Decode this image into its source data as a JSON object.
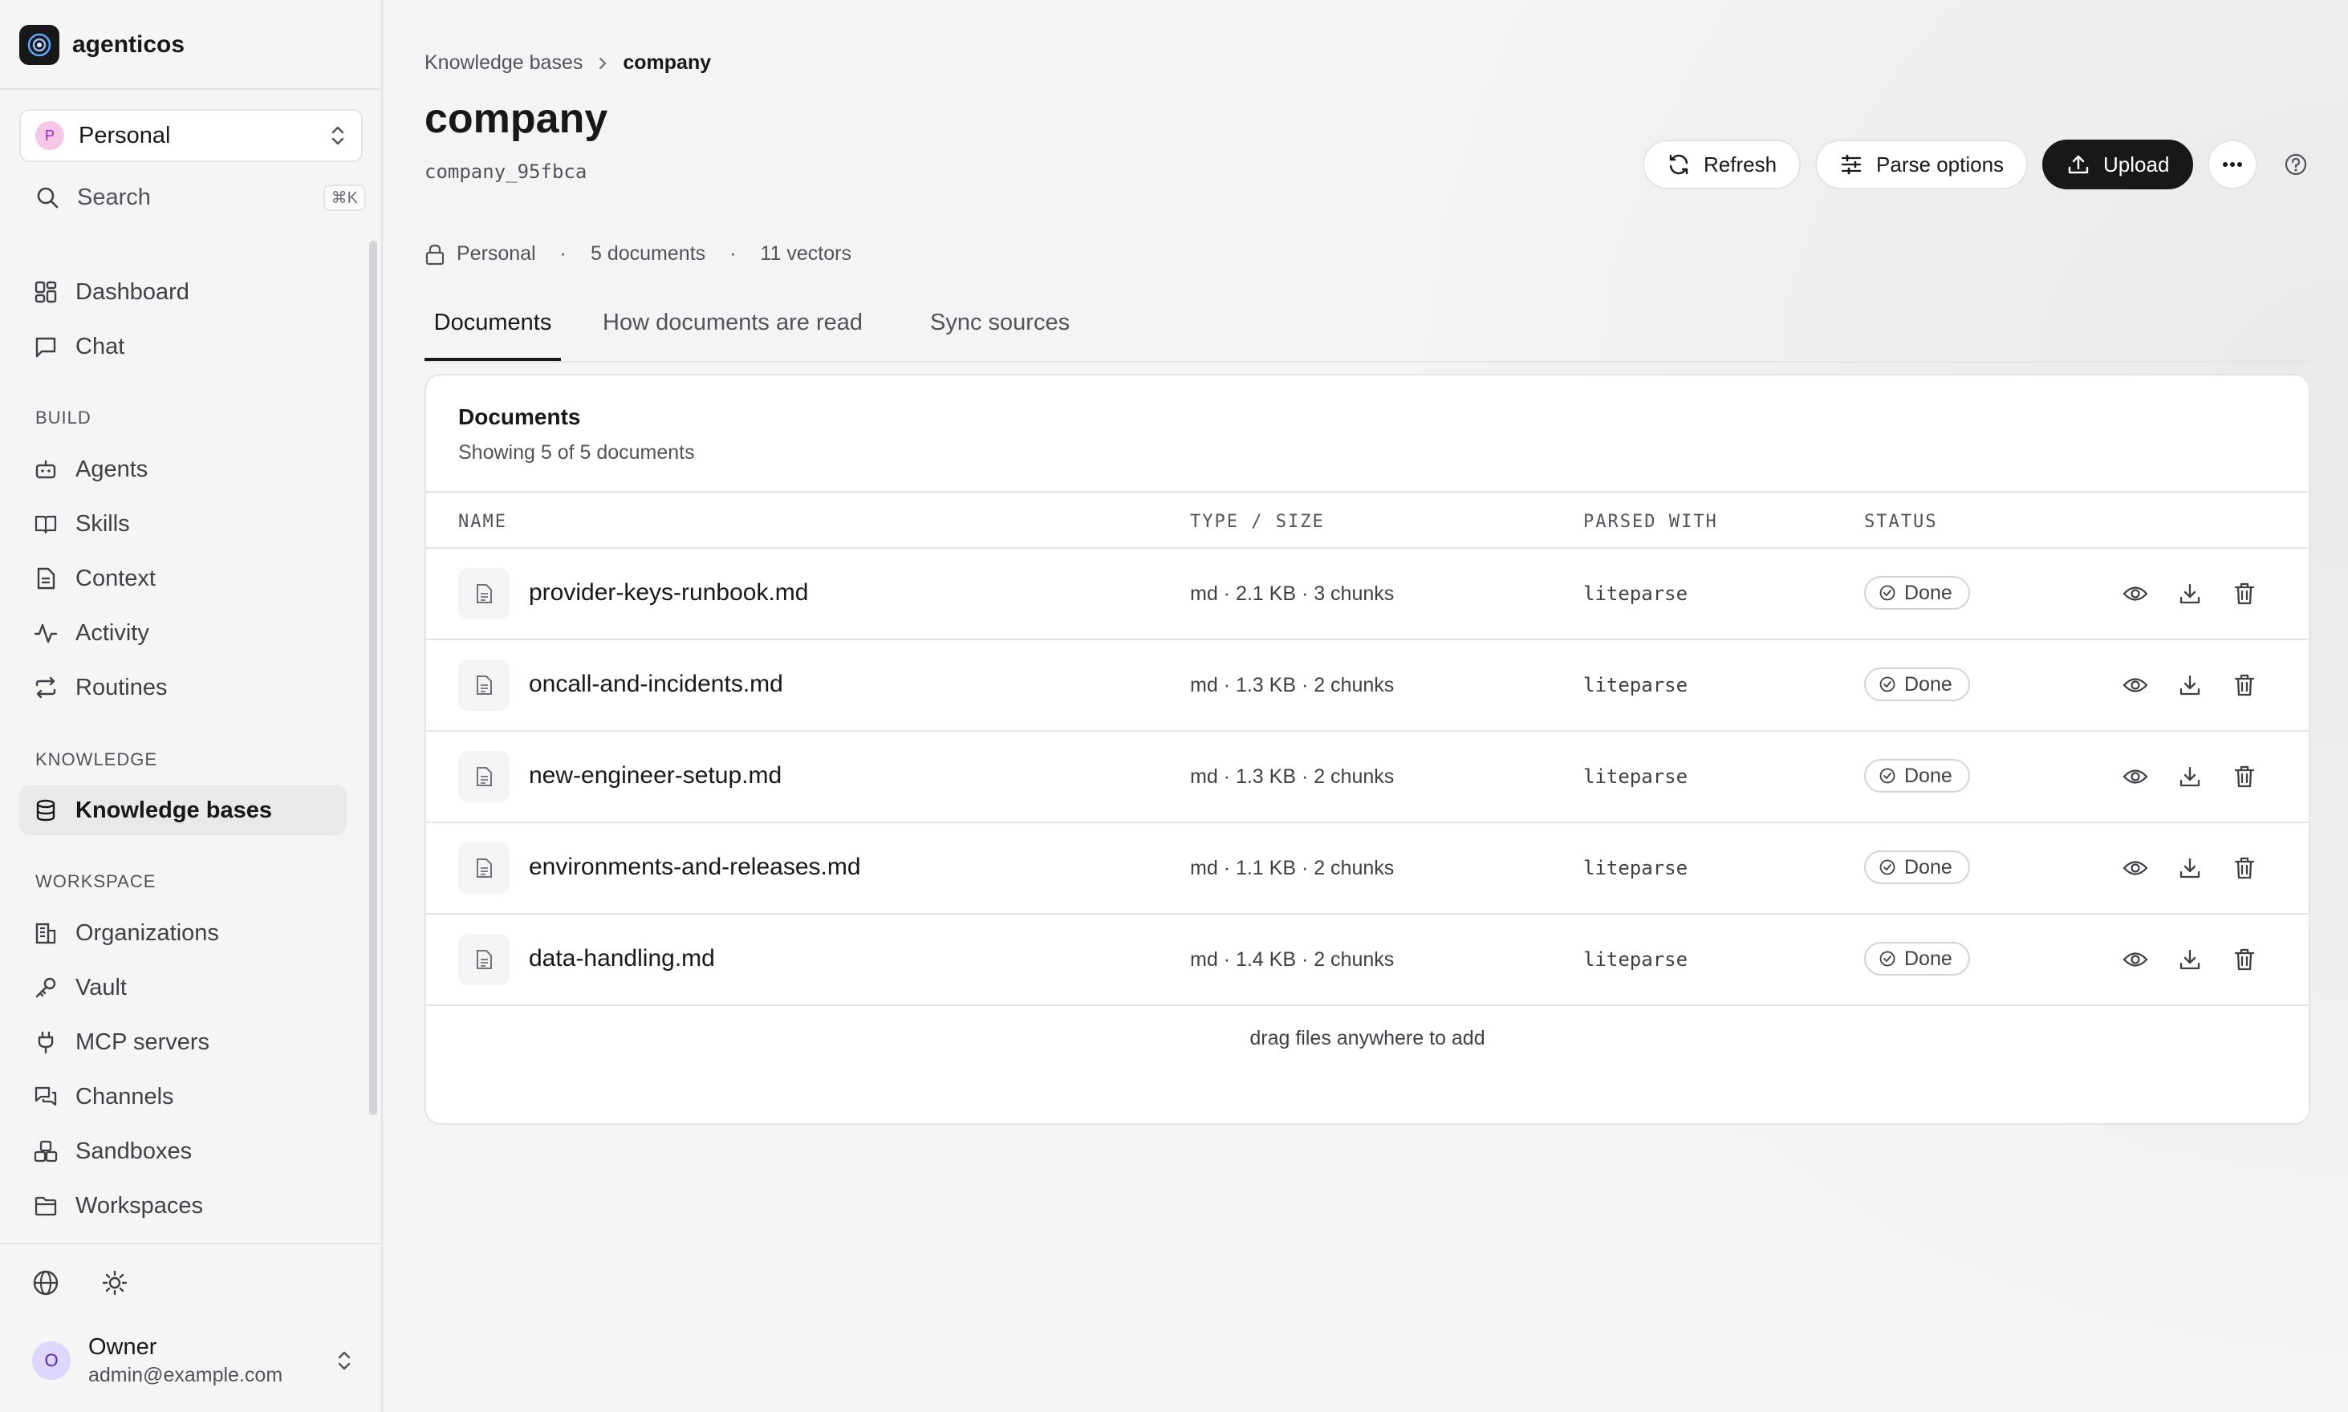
{
  "app": {
    "name": "agenticos"
  },
  "workspace": {
    "initial": "P",
    "name": "Personal"
  },
  "search": {
    "label": "Search",
    "shortcut": "⌘K"
  },
  "nav": {
    "top": [
      {
        "label": "Dashboard",
        "icon": "dashboard-icon"
      },
      {
        "label": "Chat",
        "icon": "chat-icon"
      }
    ],
    "build_title": "BUILD",
    "build": [
      {
        "label": "Agents",
        "icon": "robot-icon"
      },
      {
        "label": "Skills",
        "icon": "book-icon"
      },
      {
        "label": "Context",
        "icon": "document-icon"
      },
      {
        "label": "Activity",
        "icon": "activity-icon"
      },
      {
        "label": "Routines",
        "icon": "repeat-icon"
      }
    ],
    "knowledge_title": "KNOWLEDGE",
    "knowledge": [
      {
        "label": "Knowledge bases",
        "icon": "database-icon",
        "active": true
      }
    ],
    "workspace_title": "WORKSPACE",
    "workspace": [
      {
        "label": "Organizations",
        "icon": "building-icon"
      },
      {
        "label": "Vault",
        "icon": "key-icon"
      },
      {
        "label": "MCP servers",
        "icon": "plug-icon"
      },
      {
        "label": "Channels",
        "icon": "messages-icon"
      },
      {
        "label": "Sandboxes",
        "icon": "boxes-icon"
      },
      {
        "label": "Workspaces",
        "icon": "folder-icon"
      }
    ]
  },
  "user": {
    "initial": "O",
    "name": "Owner",
    "email": "admin@example.com"
  },
  "breadcrumb": {
    "parent": "Knowledge bases",
    "current": "company"
  },
  "page": {
    "title": "company",
    "slug": "company_95fbca"
  },
  "actions": {
    "refresh": "Refresh",
    "parse_options": "Parse options",
    "upload": "Upload"
  },
  "meta": {
    "visibility": "Personal",
    "documents": "5 documents",
    "vectors": "11 vectors",
    "separator": "·"
  },
  "tabs": [
    {
      "label": "Documents",
      "active": true
    },
    {
      "label": "How documents are read"
    },
    {
      "label": "Sync sources"
    }
  ],
  "documents": {
    "title": "Documents",
    "subtitle": "Showing 5 of 5 documents",
    "columns": {
      "name": "NAME",
      "type_size": "TYPE / SIZE",
      "parsed_with": "PARSED WITH",
      "status": "STATUS"
    },
    "rows": [
      {
        "name": "provider-keys-runbook.md",
        "size": "md · 2.1 KB · 3 chunks",
        "parser": "liteparse",
        "status": "Done"
      },
      {
        "name": "oncall-and-incidents.md",
        "size": "md · 1.3 KB · 2 chunks",
        "parser": "liteparse",
        "status": "Done"
      },
      {
        "name": "new-engineer-setup.md",
        "size": "md · 1.3 KB · 2 chunks",
        "parser": "liteparse",
        "status": "Done"
      },
      {
        "name": "environments-and-releases.md",
        "size": "md · 1.1 KB · 2 chunks",
        "parser": "liteparse",
        "status": "Done"
      },
      {
        "name": "data-handling.md",
        "size": "md · 1.4 KB · 2 chunks",
        "parser": "liteparse",
        "status": "Done"
      }
    ],
    "dropzone": "drag files anywhere to add"
  },
  "colors": {
    "primary": "#18181b",
    "border": "#e4e4e7",
    "muted_text": "#52525b",
    "active_nav_bg": "#e9e9eb"
  }
}
